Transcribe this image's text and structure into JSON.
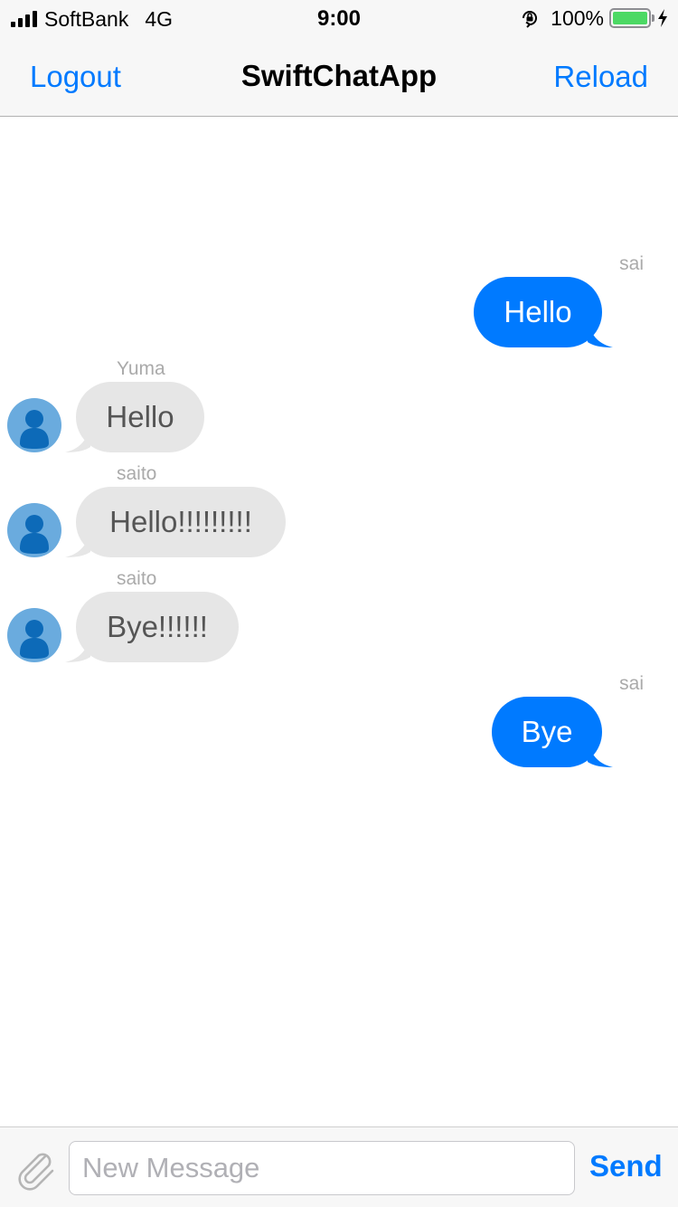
{
  "status_bar": {
    "carrier": "SoftBank",
    "network": "4G",
    "time": "9:00",
    "battery": "100%",
    "battery_level": 1.0,
    "icons": [
      "signal-bars-icon",
      "orientation-lock-icon",
      "battery-icon",
      "charging-bolt-icon"
    ]
  },
  "nav": {
    "left_label": "Logout",
    "title": "SwiftChatApp",
    "right_label": "Reload"
  },
  "messages": [
    {
      "sender": "sai",
      "text": "Hello",
      "direction": "outgoing"
    },
    {
      "sender": "Yuma",
      "text": "Hello",
      "direction": "incoming"
    },
    {
      "sender": "saito",
      "text": "Hello!!!!!!!!!",
      "direction": "incoming"
    },
    {
      "sender": "saito",
      "text": "Bye!!!!!!",
      "direction": "incoming"
    },
    {
      "sender": "sai",
      "text": "Bye",
      "direction": "outgoing"
    }
  ],
  "input": {
    "placeholder": "New Message",
    "value": "",
    "send_label": "Send"
  },
  "colors": {
    "accent": "#007aff",
    "incoming_bubble": "#e6e6e6",
    "avatar_bg": "#6aabde",
    "avatar_fg": "#0d6ab8",
    "battery": "#4cd964"
  }
}
